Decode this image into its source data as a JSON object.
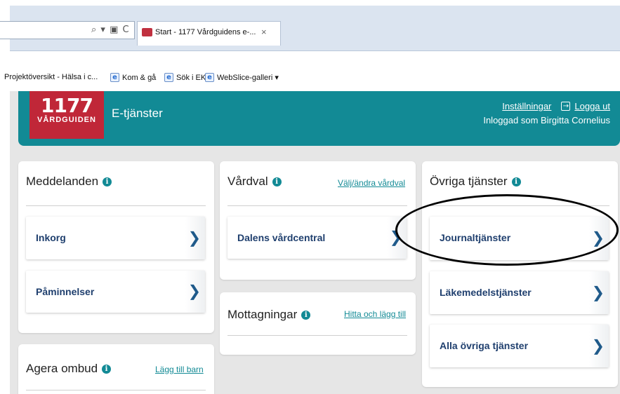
{
  "browser": {
    "address_icons": "⌕ ▾ ▣ C",
    "tab_title": "Start - 1177 Vårdguidens e-...",
    "tab_close": "×",
    "favorites": [
      {
        "label": "Projektöversikt - Hälsa i c...",
        "icon": ""
      },
      {
        "label": "Kom & gå",
        "icon": "e"
      },
      {
        "label": "Sök i EK",
        "icon": "e"
      },
      {
        "label": "WebSlice-galleri ▾",
        "icon": "e"
      }
    ]
  },
  "header": {
    "logo_num": "1177",
    "logo_sub": "VÅRDGUIDEN",
    "title": "E-tjänster",
    "settings_link": "Inställningar",
    "logout_link": "Logga ut",
    "logged_in_as": "Inloggad som Birgitta Cornelius",
    "logout_icon": "→"
  },
  "meddelanden": {
    "title": "Meddelanden",
    "items": [
      {
        "label": "Inkorg"
      },
      {
        "label": "Påminnelser"
      }
    ]
  },
  "vardval": {
    "title": "Vårdval",
    "link": "Välj/ändra vårdval",
    "items": [
      {
        "label": "Dalens vårdcentral"
      }
    ]
  },
  "mottagningar": {
    "title": "Mottagningar",
    "link": "Hitta och lägg till"
  },
  "agera_ombud": {
    "title": "Agera ombud",
    "link": "Lägg till barn"
  },
  "ovriga": {
    "title": "Övriga tjänster",
    "items": [
      {
        "label": "Journaltjänster"
      },
      {
        "label": "Läkemedelstjänster"
      },
      {
        "label": "Alla övriga tjänster"
      }
    ]
  },
  "chevron": "❯",
  "info": "i",
  "colors": {
    "teal": "#128a95",
    "logo_red": "#c02738",
    "item_text": "#1f3f6e",
    "background": "#e6e6e6"
  }
}
